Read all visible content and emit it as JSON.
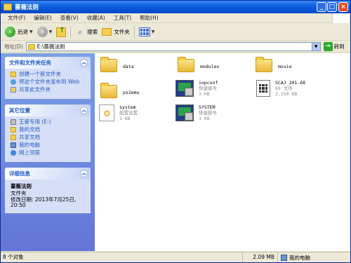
{
  "window": {
    "title": "蔷薇法则"
  },
  "menu": [
    "文件(F)",
    "编辑(E)",
    "查看(V)",
    "收藏(A)",
    "工具(T)",
    "帮助(H)"
  ],
  "toolbar": {
    "back": "后退",
    "search": "搜索",
    "folders": "文件夹"
  },
  "address": {
    "label": "地址(D)",
    "value": "E:\\蔷薇法则",
    "go": "转到"
  },
  "tasks": {
    "title": "文件和文件夹任务",
    "links": [
      "创建一个新文件夹",
      "将这个文件夹发布到 Web",
      "共享此文件夹"
    ]
  },
  "places": {
    "title": "其它位置",
    "links": [
      "王睿专用 (E:)",
      "我的文档",
      "共享文档",
      "我的电脑",
      "网上邻居"
    ]
  },
  "details": {
    "title": "详细信息",
    "name": "蔷薇法则",
    "type": "文件夹",
    "modified": "修改日期: 2013年7月25日, 20:50"
  },
  "files": [
    {
      "name": "data"
    },
    {
      "name": "modules"
    },
    {
      "name": "movie"
    },
    {
      "name": "ps2emu"
    },
    {
      "name": "iopconf",
      "sub": "快速拨号",
      "size": "1 KB"
    },
    {
      "name": "SCAJ_201.68",
      "sub": "68 文件",
      "size": "2,150 KB"
    },
    {
      "name": "system",
      "sub": "配置设置",
      "size": "1 KB"
    },
    {
      "name": "SYSTEM",
      "sub": "快速拨号",
      "size": "1 KB"
    }
  ],
  "status": {
    "count": "8 个对象",
    "size": "2.09 MB",
    "location": "我的电脑"
  }
}
